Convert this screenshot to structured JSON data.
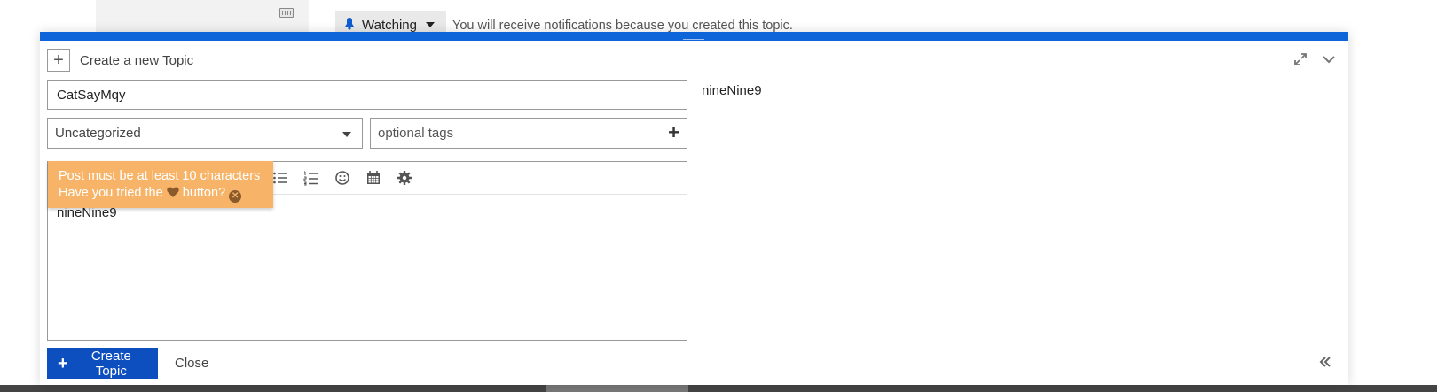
{
  "background": {
    "watching_label": "Watching",
    "watching_text": "You will receive notifications because you created this topic."
  },
  "composer": {
    "header_label": "Create a new Topic",
    "title_value": "CatSayMqy",
    "category_value": "Uncategorized",
    "tags_placeholder": "optional tags",
    "editor_text": "nineNine9",
    "preview_text": "nineNine9",
    "popup_line1": "Post must be at least 10 characters",
    "popup_line2_before": "Have you tried the",
    "popup_line2_after": "button?",
    "create_button": "Create Topic",
    "close_link": "Close"
  },
  "colors": {
    "accent": "#0e64d9",
    "button": "#0e4fbf",
    "popup": "#f7b469"
  },
  "icons": [
    "keyboard-icon",
    "bell-icon",
    "plus-icon",
    "expand-icon",
    "chevron-down-icon",
    "bullet-list-icon",
    "numbered-list-icon",
    "emoji-icon",
    "calendar-icon",
    "gear-icon",
    "heart-icon",
    "close-icon",
    "double-chevron-left-icon"
  ]
}
